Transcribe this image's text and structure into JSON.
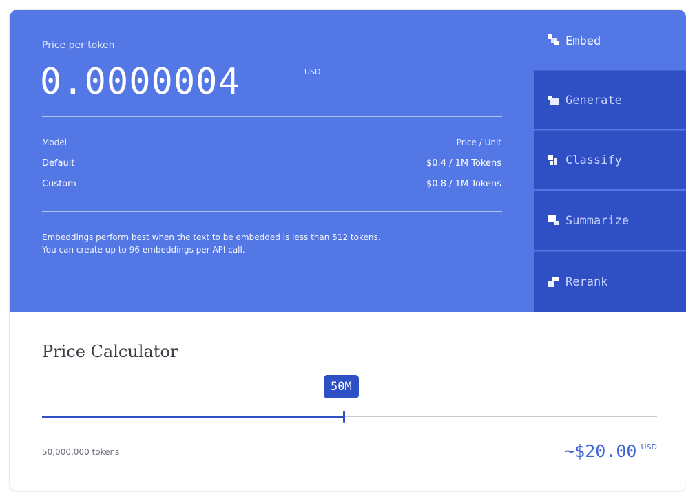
{
  "pricing": {
    "price_label": "Price per token",
    "price_value": "0.0000004",
    "price_unit": "USD",
    "table": {
      "headers": [
        "Model",
        "Price / Unit"
      ],
      "rows": [
        {
          "model": "Default",
          "price": "$0.4 / 1M Tokens"
        },
        {
          "model": "Custom",
          "price": "$0.8 / 1M Tokens"
        }
      ]
    },
    "note_line1": "Embeddings perform best when the text to be embedded is less than 512 tokens.",
    "note_line2": "You can create up to 96 embeddings per API call."
  },
  "tabs": [
    {
      "label": "Embed",
      "icon": "embed-icon",
      "active": true
    },
    {
      "label": "Generate",
      "icon": "generate-icon",
      "active": false
    },
    {
      "label": "Classify",
      "icon": "classify-icon",
      "active": false
    },
    {
      "label": "Summarize",
      "icon": "summarize-icon",
      "active": false
    },
    {
      "label": "Rerank",
      "icon": "rerank-icon",
      "active": false
    }
  ],
  "calculator": {
    "title": "Price Calculator",
    "badge": "50M",
    "slider_fraction": 0.49,
    "tokens_text": "50,000,000 tokens",
    "total_value": "~$20.00",
    "total_unit": "USD"
  },
  "colors": {
    "top_bg": "#5477e6",
    "tab_inactive_bg": "#2f4fc4",
    "accent": "#3f63d8"
  }
}
